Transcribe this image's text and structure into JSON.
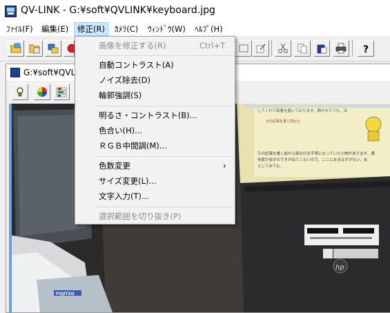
{
  "window": {
    "title": "QV-LINK - G:¥soft¥QVLINK¥keyboard.jpg"
  },
  "menubar": {
    "items": [
      {
        "label": "ﾌｧｲﾙ(F)"
      },
      {
        "label": "編集(E)"
      },
      {
        "label": "修正(R)"
      },
      {
        "label": "ｶﾒﾗ(C)"
      },
      {
        "label": "ｳｨﾝﾄﾞｳ(W)"
      },
      {
        "label": "ﾍﾙﾌﾟ(H)"
      }
    ]
  },
  "toolbar": {
    "icons": [
      "open-folder-icon",
      "folder-image-icon",
      "image-list-icon",
      "record-icon",
      "stamp-icon",
      "edit-note-icon",
      "scissors-icon",
      "copy-icon",
      "paste-icon",
      "printer-icon",
      "help-icon"
    ]
  },
  "child_window": {
    "title": "G:¥soft¥QVLINK¥keyboard.jpg",
    "title_visible": "G:¥soft¥QVLI",
    "icons": [
      "lightbulb-icon",
      "color-wheel-icon",
      "rgb-sliders-icon"
    ]
  },
  "photo": {
    "screen_text": [
      "してくれて新着を届いております。静かなりても、ほ",
      "その記事を書く前から",
      "その記事を書く前から新仕行方不明になっていた小物がありまず、通",
      "何度か探すのですが出てこないので、ここにあるはずがない。あ",
      "としてみても、"
    ],
    "laptop_brand": "hp",
    "keyboard_brand": "FUJITSU"
  },
  "dropdown": {
    "items": [
      {
        "label": "画像を修正する(R)",
        "shortcut": "Ctrl+T",
        "disabled": true
      },
      {
        "separator": true
      },
      {
        "label": "自動コントラスト(A)"
      },
      {
        "label": "ノイズ除去(D)"
      },
      {
        "label": "輪郭強調(S)"
      },
      {
        "separator": true
      },
      {
        "label": "明るさ・コントラスト(B)..."
      },
      {
        "label": "色合い(H)..."
      },
      {
        "label": "ＲＧＢ中間調(M)..."
      },
      {
        "separator": true
      },
      {
        "label": "色数変更",
        "submenu": true,
        "arrow": "›"
      },
      {
        "label": "サイズ変更(L)..."
      },
      {
        "label": "文字入力(T)..."
      },
      {
        "separator": true
      },
      {
        "label": "選択範囲を切り抜き(P)",
        "disabled": true
      }
    ]
  }
}
